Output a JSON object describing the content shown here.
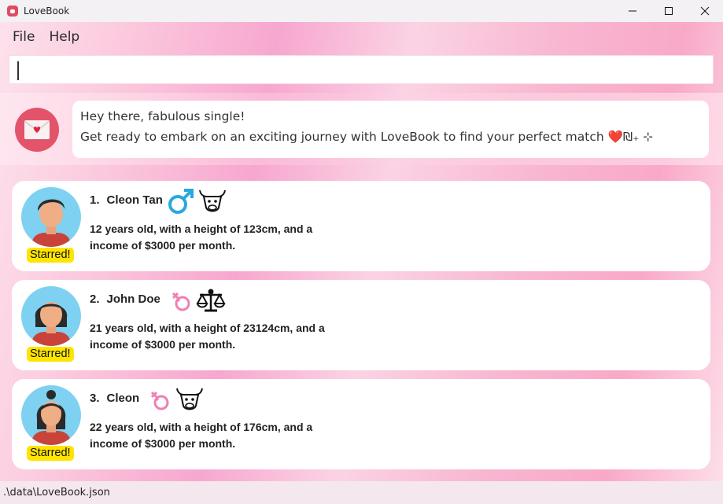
{
  "window": {
    "title": "LoveBook",
    "controls": [
      "minimize",
      "maximize",
      "close"
    ]
  },
  "menu": {
    "items": [
      "File",
      "Help"
    ]
  },
  "command": {
    "value": "",
    "placeholder": ""
  },
  "result": {
    "line1": "Hey there, fabulous single!",
    "line2": "Get ready to embark on an exciting journey with LoveBook to find your perfect match ❤️₪₊ ⊹"
  },
  "dates": [
    {
      "index": "1.",
      "name": "Cleon Tan",
      "gender_icon": "male-symbol-icon",
      "horoscope_icon": "taurus-ox-icon",
      "description": "12 years old, with a height of 123cm, and a income of $3000 per month.",
      "badge": "Starred!",
      "avatar": "male-avatar"
    },
    {
      "index": "2.",
      "name": "John Doe",
      "gender_icon": "female-sparkle-icon",
      "horoscope_icon": "libra-scales-icon",
      "description": "21 years old, with a height of 23124cm, and a income of $3000 per month.",
      "badge": "Starred!",
      "avatar": "female-avatar-short-hair"
    },
    {
      "index": "3.",
      "name": "Cleon",
      "gender_icon": "female-sparkle-icon",
      "horoscope_icon": "taurus-ox-icon",
      "description": "22 years old, with a height of 176cm, and a income of $3000 per month.",
      "badge": "Starred!",
      "avatar": "female-avatar-bun"
    }
  ],
  "status": {
    "path": ".\\data\\LoveBook.json"
  },
  "colors": {
    "accent": "#e3546a",
    "badge": "#ffe400",
    "male_icon": "#29a8e0",
    "female_icon": "#f07fb4"
  }
}
